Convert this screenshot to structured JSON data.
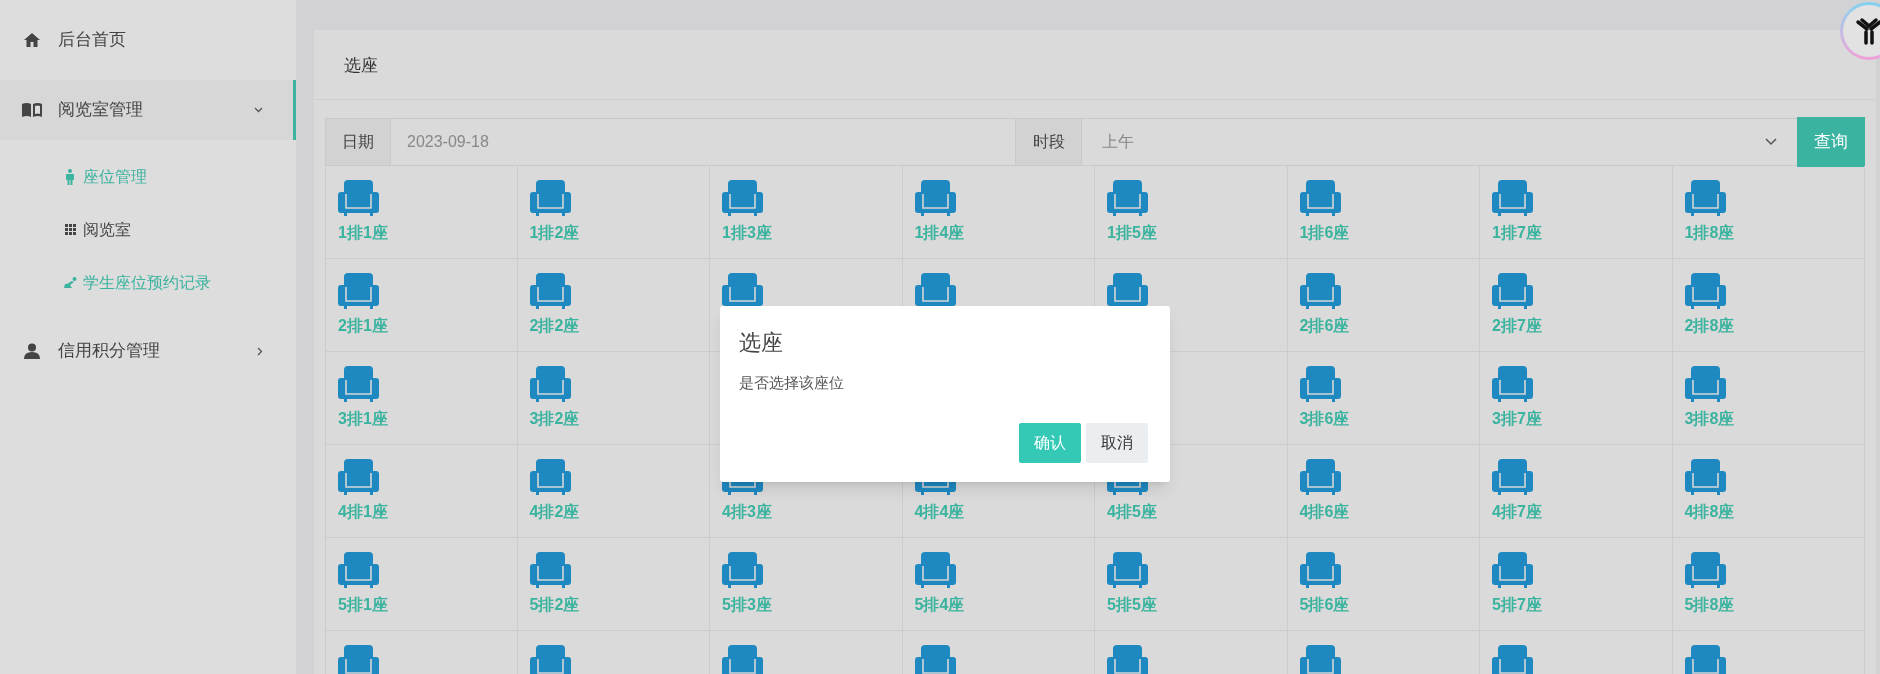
{
  "sidebar": {
    "items": [
      {
        "label": "后台首页",
        "selected": false
      },
      {
        "label": "阅览室管理",
        "selected": true,
        "expanded": true,
        "children": [
          {
            "label": "座位管理",
            "selected": true
          },
          {
            "label": "阅览室",
            "selected": false
          },
          {
            "label": "学生座位预约记录",
            "selected": true
          }
        ]
      },
      {
        "label": "信用积分管理",
        "selected": false,
        "expanded": false
      }
    ]
  },
  "card": {
    "title": "选座"
  },
  "filter": {
    "date_label": "日期",
    "date_value": "2023-09-18",
    "period_label": "时段",
    "period_value": "上午",
    "query_button": "查询"
  },
  "seat_rows": [
    [
      "1排1座",
      "1排2座",
      "1排3座",
      "1排4座",
      "1排5座",
      "1排6座",
      "1排7座",
      "1排8座"
    ],
    [
      "2排1座",
      "2排2座",
      null,
      null,
      null,
      "2排6座",
      "2排7座",
      "2排8座"
    ],
    [
      "3排1座",
      "3排2座",
      null,
      null,
      null,
      "3排6座",
      "3排7座",
      "3排8座"
    ],
    [
      "4排1座",
      "4排2座",
      "4排3座",
      "4排4座",
      "4排5座",
      "4排6座",
      "4排7座",
      "4排8座"
    ],
    [
      "5排1座",
      "5排2座",
      "5排3座",
      "5排4座",
      "5排5座",
      "5排6座",
      "5排7座",
      "5排8座"
    ],
    [
      null,
      null,
      null,
      null,
      null,
      null,
      null,
      null
    ]
  ],
  "modal": {
    "title": "选座",
    "message": "是否选择该座位",
    "buttons": [
      {
        "label": "确认",
        "kind": "primary"
      },
      {
        "label": "取消",
        "kind": "secondary"
      }
    ]
  }
}
